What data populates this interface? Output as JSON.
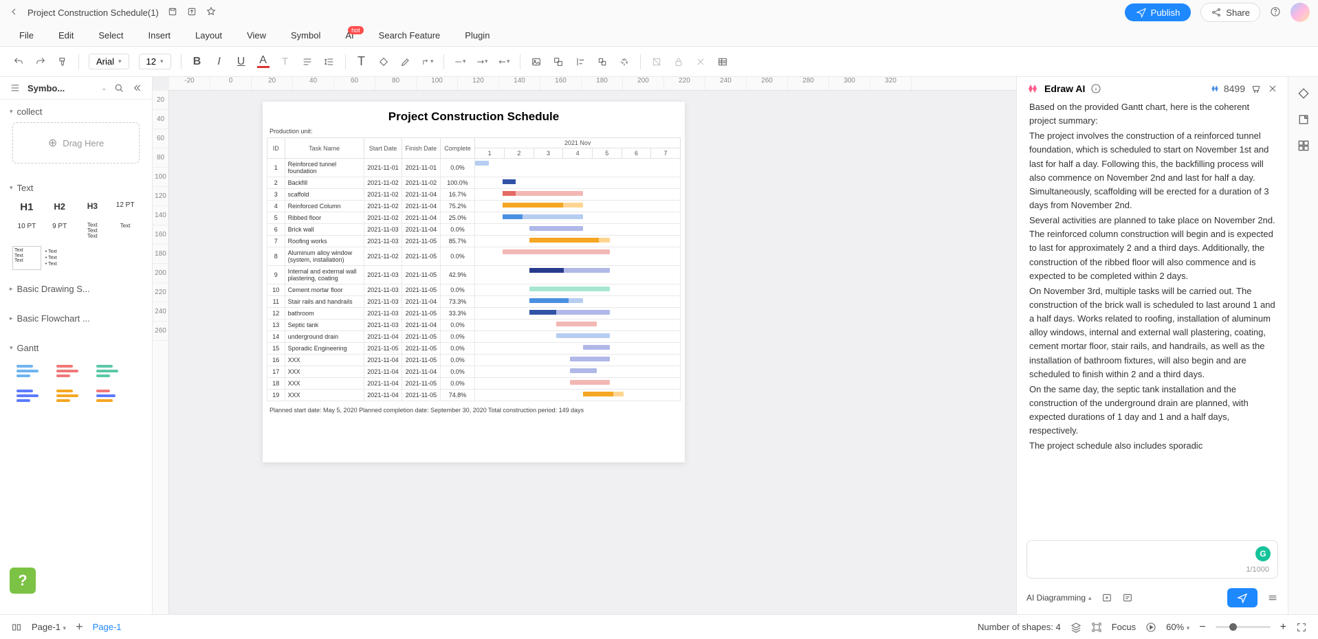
{
  "titlebar": {
    "docTitle": "Project Construction Schedule(1)",
    "publish": "Publish",
    "share": "Share"
  },
  "menu": {
    "file": "File",
    "edit": "Edit",
    "select": "Select",
    "insert": "Insert",
    "layout": "Layout",
    "view": "View",
    "symbol": "Symbol",
    "ai": "AI",
    "hot": "hot",
    "search": "Search Feature",
    "plugin": "Plugin"
  },
  "toolbar": {
    "font": "Arial",
    "size": "12"
  },
  "sidebar": {
    "title": "Symbo...",
    "collect": "collect",
    "dragHere": "Drag Here",
    "text": "Text",
    "h1": "H1",
    "h2": "H2",
    "h3": "H3",
    "pt12": "12 PT",
    "pt10": "10 PT",
    "pt9": "9 PT",
    "basicDrawing": "Basic Drawing S...",
    "basicFlowchart": "Basic Flowchart ...",
    "gantt": "Gantt"
  },
  "rulerH": [
    "-20",
    "0",
    "20",
    "40",
    "60",
    "80",
    "100",
    "120",
    "140",
    "160",
    "180",
    "200",
    "220",
    "240",
    "260",
    "280",
    "300",
    "320"
  ],
  "rulerV": [
    "20",
    "40",
    "60",
    "80",
    "100",
    "120",
    "140",
    "160",
    "180",
    "200",
    "220",
    "240",
    "260"
  ],
  "chart_data": {
    "type": "table",
    "title": "Project Construction Schedule",
    "productionUnit": "Production unit:",
    "columns": [
      "ID",
      "Task Name",
      "Start Date",
      "Finish Date",
      "Complete"
    ],
    "monthHeader": "2021 Nov",
    "days": [
      "1",
      "2",
      "3",
      "4",
      "5",
      "6",
      "7"
    ],
    "rows": [
      {
        "id": 1,
        "name": "Reinforced tunnel foundation",
        "start": "2021-11-01",
        "finish": "2021-11-01",
        "complete": "0.0%",
        "barStart": 0,
        "barLen": 7,
        "color": "#b6cdf2",
        "progColor": "#3f6fc8",
        "prog": 0
      },
      {
        "id": 2,
        "name": "Backfill",
        "start": "2021-11-02",
        "finish": "2021-11-02",
        "complete": "100.0%",
        "barStart": 14,
        "barLen": 7,
        "color": "#f3b7b4",
        "progColor": "#3152a6",
        "prog": 100
      },
      {
        "id": 3,
        "name": "scaffold",
        "start": "2021-11-02",
        "finish": "2021-11-04",
        "complete": "16.7%",
        "barStart": 14,
        "barLen": 42,
        "color": "#f3b7b4",
        "progColor": "#e46a63",
        "prog": 16.7
      },
      {
        "id": 4,
        "name": "Reinforced Column",
        "start": "2021-11-02",
        "finish": "2021-11-04",
        "complete": "75.2%",
        "barStart": 14,
        "barLen": 42,
        "color": "#ffd591",
        "progColor": "#f5a623",
        "prog": 75.2
      },
      {
        "id": 5,
        "name": "Ribbed floor",
        "start": "2021-11-02",
        "finish": "2021-11-04",
        "complete": "25.0%",
        "barStart": 14,
        "barLen": 42,
        "color": "#b6cdf2",
        "progColor": "#4a90e2",
        "prog": 25
      },
      {
        "id": 6,
        "name": "Brick wall",
        "start": "2021-11-03",
        "finish": "2021-11-04",
        "complete": "0.0%",
        "barStart": 28,
        "barLen": 28,
        "color": "#b0b8e8",
        "progColor": "#6b7dd6",
        "prog": 0
      },
      {
        "id": 7,
        "name": "Roofing works",
        "start": "2021-11-03",
        "finish": "2021-11-05",
        "complete": "85.7%",
        "barStart": 28,
        "barLen": 42,
        "color": "#ffd591",
        "progColor": "#f5a623",
        "prog": 85.7
      },
      {
        "id": 8,
        "name": "Aluminum alloy window (system, installation)",
        "start": "2021-11-02",
        "finish": "2021-11-05",
        "complete": "0.0%",
        "barStart": 14,
        "barLen": 56,
        "color": "#f3b7b4",
        "progColor": "#e46a63",
        "prog": 0
      },
      {
        "id": 9,
        "name": "Internal and external wall plastering, coating",
        "start": "2021-11-03",
        "finish": "2021-11-05",
        "complete": "42.9%",
        "barStart": 28,
        "barLen": 42,
        "color": "#b0b8e8",
        "progColor": "#273a8c",
        "prog": 42.9
      },
      {
        "id": 10,
        "name": "Cement mortar floor",
        "start": "2021-11-03",
        "finish": "2021-11-05",
        "complete": "0.0%",
        "barStart": 28,
        "barLen": 42,
        "color": "#a8e6d4",
        "progColor": "#46c8a6",
        "prog": 0
      },
      {
        "id": 11,
        "name": "Stair rails and handrails",
        "start": "2021-11-03",
        "finish": "2021-11-04",
        "complete": "73.3%",
        "barStart": 28,
        "barLen": 28,
        "color": "#b6cdf2",
        "progColor": "#4a90e2",
        "prog": 73.3
      },
      {
        "id": 12,
        "name": "bathroom",
        "start": "2021-11-03",
        "finish": "2021-11-05",
        "complete": "33.3%",
        "barStart": 28,
        "barLen": 42,
        "color": "#b0b8e8",
        "progColor": "#3152a6",
        "prog": 33.3
      },
      {
        "id": 13,
        "name": "Septic tank",
        "start": "2021-11-03",
        "finish": "2021-11-04",
        "complete": "0.0%",
        "barStart": 42,
        "barLen": 21,
        "color": "#f3b7b4",
        "progColor": "#e46a63",
        "prog": 0
      },
      {
        "id": 14,
        "name": "underground drain",
        "start": "2021-11-04",
        "finish": "2021-11-05",
        "complete": "0.0%",
        "barStart": 42,
        "barLen": 28,
        "color": "#b6cdf2",
        "progColor": "#4a90e2",
        "prog": 0
      },
      {
        "id": 15,
        "name": "Sporadic Engineering",
        "start": "2021-11-05",
        "finish": "2021-11-05",
        "complete": "0.0%",
        "barStart": 56,
        "barLen": 14,
        "color": "#b0b8e8",
        "progColor": "#6b7dd6",
        "prog": 0
      },
      {
        "id": 16,
        "name": "XXX",
        "start": "2021-11-04",
        "finish": "2021-11-05",
        "complete": "0.0%",
        "barStart": 49,
        "barLen": 21,
        "color": "#b0b8e8",
        "progColor": "#6b7dd6",
        "prog": 0
      },
      {
        "id": 17,
        "name": "XXX",
        "start": "2021-11-04",
        "finish": "2021-11-04",
        "complete": "0.0%",
        "barStart": 49,
        "barLen": 14,
        "color": "#b0b8e8",
        "progColor": "#6b7dd6",
        "prog": 0
      },
      {
        "id": 18,
        "name": "XXX",
        "start": "2021-11-04",
        "finish": "2021-11-05",
        "complete": "0.0%",
        "barStart": 49,
        "barLen": 21,
        "color": "#f3b7b4",
        "progColor": "#e46a63",
        "prog": 0
      },
      {
        "id": 19,
        "name": "XXX",
        "start": "2021-11-04",
        "finish": "2021-11-05",
        "complete": "74.8%",
        "barStart": 56,
        "barLen": 21,
        "color": "#ffd591",
        "progColor": "#f5a623",
        "prog": 74.8
      }
    ],
    "footerNote": "Planned start date: May 5, 2020 Planned completion date: September 30, 2020 Total construction period: 149 days"
  },
  "ai": {
    "title": "Edraw AI",
    "credits": "8499",
    "body": "Based on the provided Gantt chart, here is the coherent project summary:\nThe project involves the construction of a reinforced tunnel foundation, which is scheduled to start on November 1st and last for half a day. Following this, the backfilling process will also commence on November 2nd and last for half a day. Simultaneously, scaffolding will be erected for a duration of 3 days from November 2nd.\nSeveral activities are planned to take place on November 2nd. The reinforced column construction will begin and is expected to last for approximately 2 and a third days. Additionally, the construction of the ribbed floor will also commence and is expected to be completed within 2 days.\nOn November 3rd, multiple tasks will be carried out. The construction of the brick wall is scheduled to last around 1 and a half days. Works related to roofing, installation of aluminum alloy windows, internal and external wall plastering, coating, cement mortar floor, stair rails, and handrails, as well as the installation of bathroom fixtures, will also begin and are scheduled to finish within 2 and a third days.\nOn the same day, the septic tank installation and the construction of the underground drain are planned, with expected durations of 1 day and 1 and a half days, respectively.\nThe project schedule also includes sporadic",
    "counter": "1/1000",
    "diagramming": "AI Diagramming"
  },
  "status": {
    "page": "Page-1",
    "pageTab": "Page-1",
    "shapes": "Number of shapes: 4",
    "focus": "Focus",
    "zoom": "60%"
  }
}
